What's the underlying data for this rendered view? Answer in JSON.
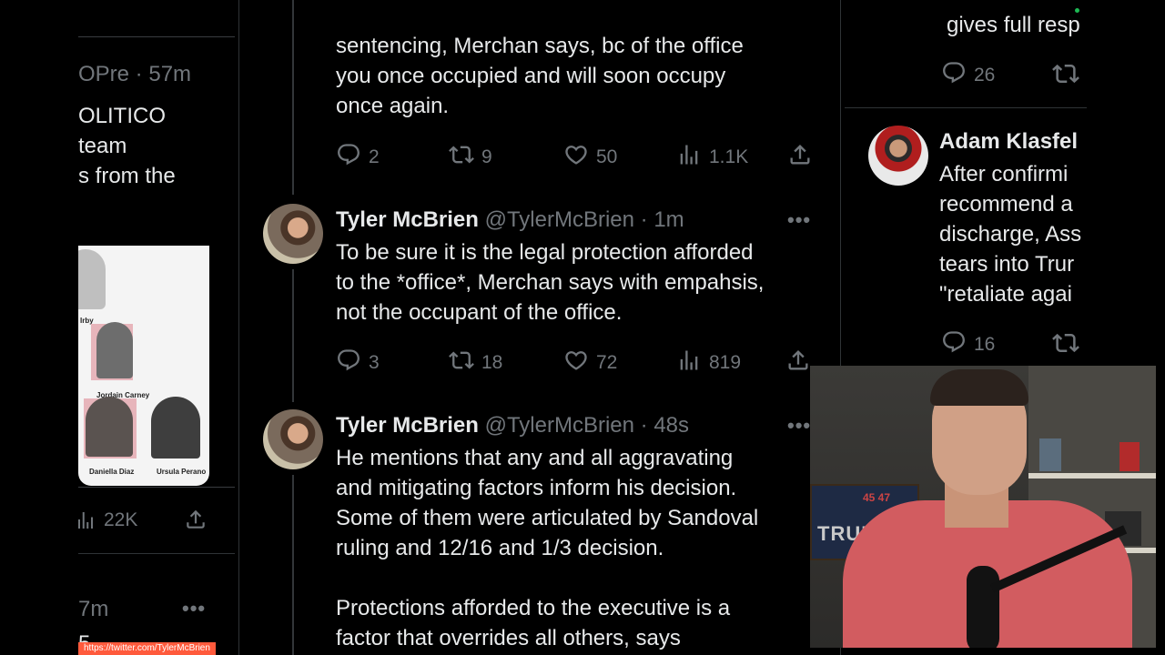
{
  "left_card": {
    "handle_time": "OPre · 57m",
    "text_lines": [
      "OLITICO",
      "team",
      "s from the"
    ],
    "image_labels": [
      "Jordain Carney",
      "Daniella Diaz",
      "Ursula Perano",
      "Irby"
    ],
    "views": "22K",
    "next_time": "7m",
    "next_text": "5 "
  },
  "main": {
    "tweet0": {
      "text_lines": [
        "sentencing, Merchan says, bc of the office",
        "you once occupied and will soon occupy",
        "once again."
      ],
      "replies": "2",
      "reposts": "9",
      "likes": "50",
      "views": "1.1K"
    },
    "tweet1": {
      "name": "Tyler McBrien",
      "handle": "@TylerMcBrien",
      "time": "· 1m",
      "text_lines": [
        "To be sure it is the legal protection afforded",
        "to the *office*, Merchan says with empahsis,",
        "not the occupant of the office."
      ],
      "replies": "3",
      "reposts": "18",
      "likes": "72",
      "views": "819"
    },
    "tweet2": {
      "name": "Tyler McBrien",
      "handle": "@TylerMcBrien",
      "time": "· 48s",
      "text_lines": [
        "He mentions that any and all aggravating",
        "and mitigating factors inform his decision.",
        "Some of them were articulated by Sandoval",
        "ruling and 12/16 and 1/3 decision.",
        "",
        "Protections afforded to the executive is a",
        "factor that overrides all others, says"
      ]
    }
  },
  "right": {
    "top_text": "gives full resp",
    "replies_top": "26",
    "tweet": {
      "name": "Adam Klasfel",
      "text_lines": [
        "After confirmi",
        "recommend a",
        "discharge, Ass",
        "tears into Trur",
        "\"retaliate agai"
      ],
      "replies": "16"
    }
  },
  "overlay": {
    "url": "https://twitter.com/TylerMcBrien",
    "sign_text": "TRUMP",
    "sign_small": "45 47"
  },
  "colors": {
    "text": "#e7e9ea",
    "muted": "#71767b",
    "border": "#2f3336",
    "url_bar": "#ff5a3c"
  }
}
